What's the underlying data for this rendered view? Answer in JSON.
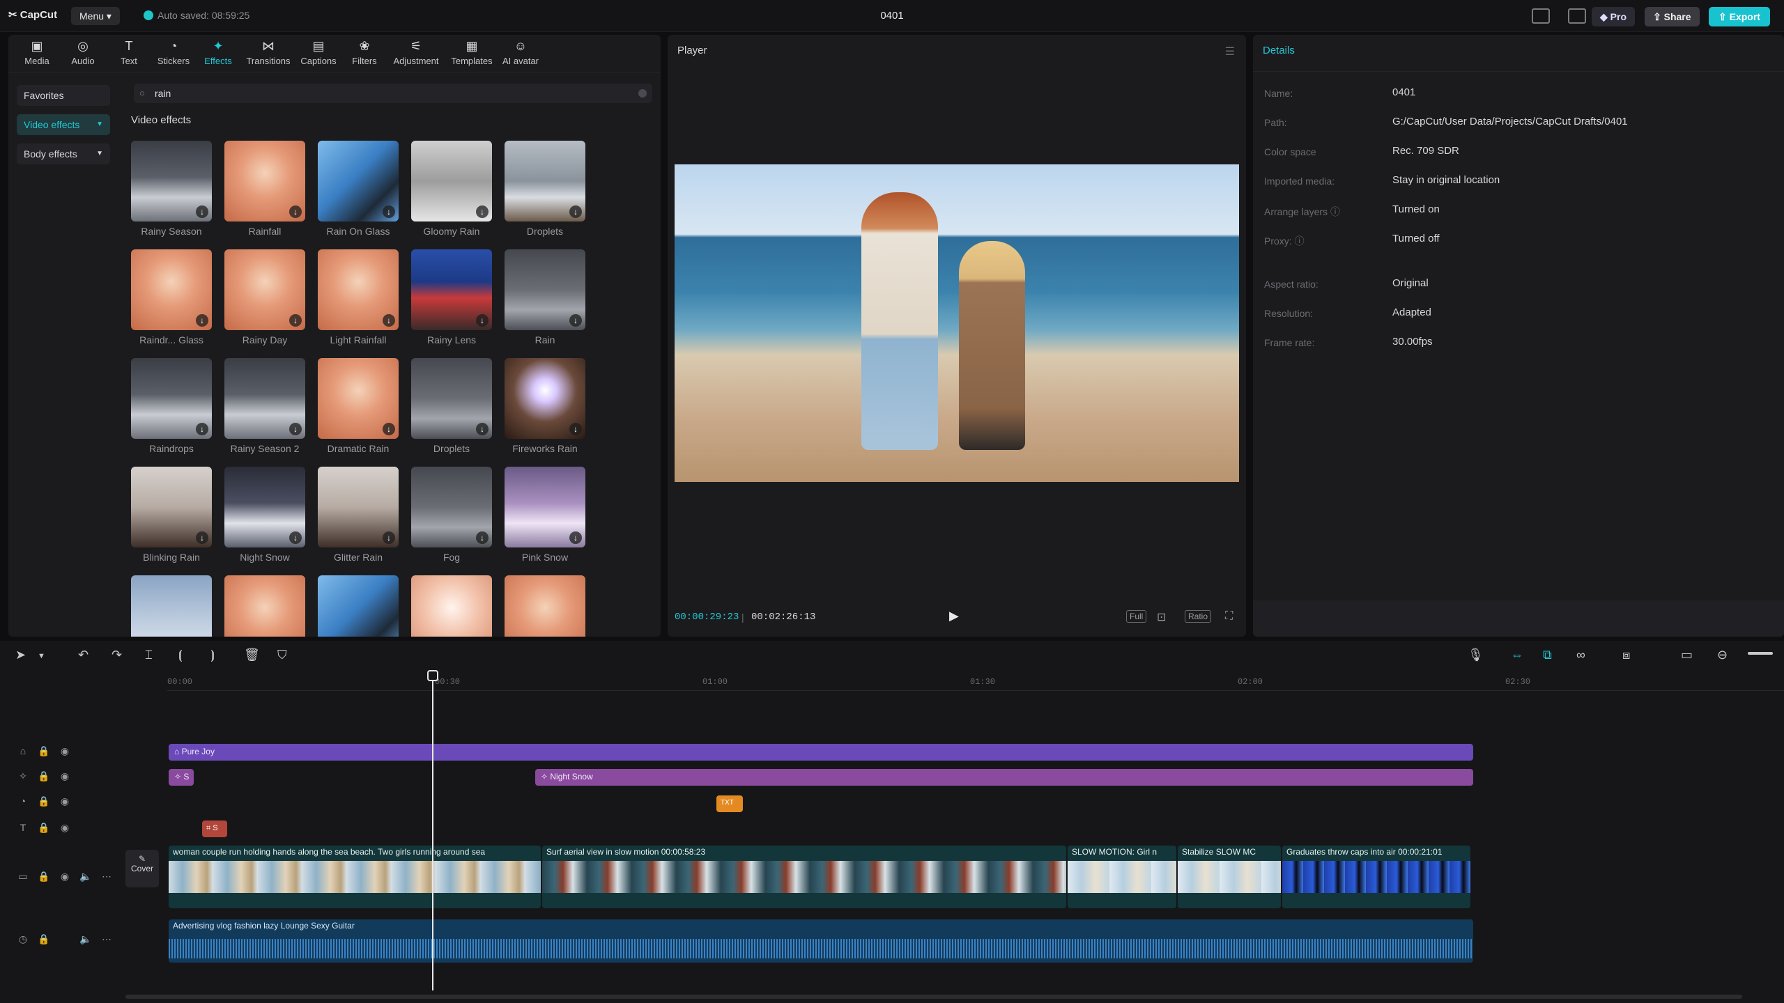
{
  "app": {
    "brand": "CapCut",
    "menu_label": "Menu",
    "autosave": "Auto saved: 08:59:25",
    "project_title": "0401",
    "pro_label": "Pro",
    "share_label": "Share",
    "export_label": "Export"
  },
  "toolbar": {
    "tabs": [
      {
        "label": "Media",
        "icon": "media-icon"
      },
      {
        "label": "Audio",
        "icon": "audio-icon"
      },
      {
        "label": "Text",
        "icon": "text-icon"
      },
      {
        "label": "Stickers",
        "icon": "stickers-icon"
      },
      {
        "label": "Effects",
        "icon": "effects-icon",
        "active": true
      },
      {
        "label": "Transitions",
        "icon": "transitions-icon"
      },
      {
        "label": "Captions",
        "icon": "captions-icon"
      },
      {
        "label": "Filters",
        "icon": "filters-icon"
      },
      {
        "label": "Adjustment",
        "icon": "adjustment-icon"
      },
      {
        "label": "Templates",
        "icon": "templates-icon"
      },
      {
        "label": "AI avatar",
        "icon": "ai-avatar-icon"
      }
    ]
  },
  "sidebar": {
    "favorites": "Favorites",
    "video_effects": "Video effects",
    "body_effects": "Body effects"
  },
  "search": {
    "value": "rain"
  },
  "effects": {
    "section_title": "Video effects",
    "items": [
      {
        "label": "Rainy Season"
      },
      {
        "label": "Rainfall"
      },
      {
        "label": "Rain On Glass"
      },
      {
        "label": "Gloomy Rain"
      },
      {
        "label": "Droplets"
      },
      {
        "label": "Raindr... Glass"
      },
      {
        "label": "Rainy Day"
      },
      {
        "label": "Light Rainfall"
      },
      {
        "label": "Rainy Lens"
      },
      {
        "label": "Rain"
      },
      {
        "label": "Raindrops"
      },
      {
        "label": "Rainy Season 2"
      },
      {
        "label": "Dramatic Rain"
      },
      {
        "label": "Droplets"
      },
      {
        "label": "Fireworks Rain"
      },
      {
        "label": "Blinking Rain"
      },
      {
        "label": "Night Snow"
      },
      {
        "label": "Glitter Rain"
      },
      {
        "label": "Fog"
      },
      {
        "label": "Pink Snow"
      },
      {
        "label": ""
      },
      {
        "label": ""
      },
      {
        "label": ""
      },
      {
        "label": ""
      },
      {
        "label": ""
      }
    ]
  },
  "player": {
    "title": "Player",
    "current_time": "00:00:29:23",
    "total_time": "00:02:26:13",
    "full_label": "Full",
    "ratio_label": "Ratio"
  },
  "details": {
    "title": "Details",
    "rows": [
      {
        "key": "Name:",
        "value": "0401"
      },
      {
        "key": "Path:",
        "value": "G:/CapCut/User Data/Projects/CapCut Drafts/0401"
      },
      {
        "key": "Color space",
        "value": "Rec. 709 SDR"
      },
      {
        "key": "Imported media:",
        "value": "Stay in original location"
      },
      {
        "key": "Arrange layers",
        "value": "Turned on"
      },
      {
        "key": "Proxy:",
        "value": "Turned off"
      },
      {
        "key": "Aspect ratio:",
        "value": "Original"
      },
      {
        "key": "Resolution:",
        "value": "Adapted"
      },
      {
        "key": "Frame rate:",
        "value": "30.00fps"
      }
    ]
  },
  "timeline": {
    "ruler": [
      "00:00",
      "00:30",
      "01:00",
      "01:30",
      "02:00",
      "02:30"
    ],
    "tracks": {
      "pure_joy": "Pure Joy",
      "effect_small": "S",
      "night_snow": "Night Snow",
      "orange_tag": "TXT",
      "red_tag": "S"
    },
    "video_clips": [
      {
        "label": "woman couple run holding hands along the sea beach. Two girls running around sea"
      },
      {
        "label": "Surf aerial view in slow motion  00:00:58:23"
      },
      {
        "label": "SLOW MOTION: Girl n"
      },
      {
        "label": "Stabilize  SLOW MC"
      },
      {
        "label": "Graduates throw caps into air  00:00:21:01"
      }
    ],
    "cover_label": "Cover",
    "audio_label": "Advertising vlog fashion lazy Lounge Sexy Guitar"
  },
  "colors": {
    "accent": "#22c9d6",
    "effect_track": "#6a49b8",
    "video_track": "#12363a",
    "audio_track": "#123a5a"
  }
}
